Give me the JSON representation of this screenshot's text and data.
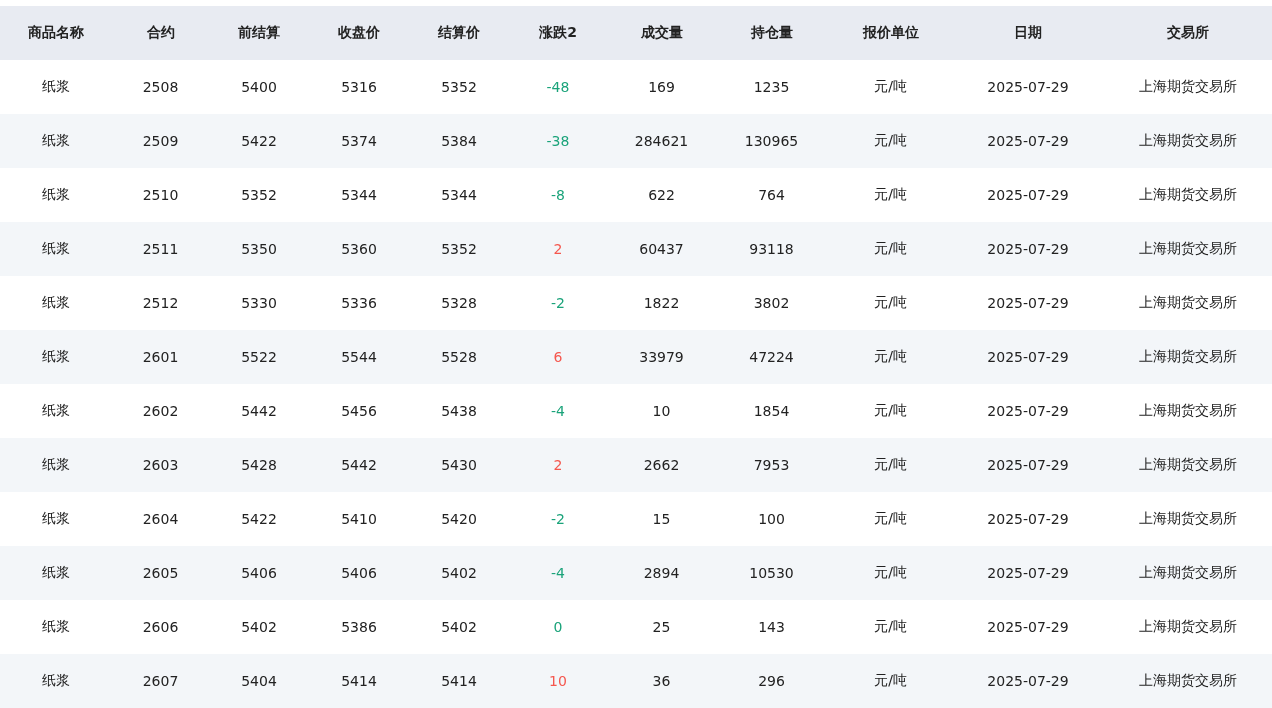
{
  "table": {
    "columns": [
      "商品名称",
      "合约",
      "前结算",
      "收盘价",
      "结算价",
      "涨跌2",
      "成交量",
      "持仓量",
      "报价单位",
      "日期",
      "交易所"
    ],
    "rows": [
      {
        "cells": [
          "纸浆",
          "2508",
          "5400",
          "5316",
          "5352",
          "-48",
          "169",
          "1235",
          "元/吨",
          "2025-07-29",
          "上海期货交易所"
        ],
        "color": "#1aa37a"
      },
      {
        "cells": [
          "纸浆",
          "2509",
          "5422",
          "5374",
          "5384",
          "-38",
          "284621",
          "130965",
          "元/吨",
          "2025-07-29",
          "上海期货交易所"
        ],
        "color": "#1aa37a"
      },
      {
        "cells": [
          "纸浆",
          "2510",
          "5352",
          "5344",
          "5344",
          "-8",
          "622",
          "764",
          "元/吨",
          "2025-07-29",
          "上海期货交易所"
        ],
        "color": "#1aa37a"
      },
      {
        "cells": [
          "纸浆",
          "2511",
          "5350",
          "5360",
          "5352",
          "2",
          "60437",
          "93118",
          "元/吨",
          "2025-07-29",
          "上海期货交易所"
        ],
        "color": "#f5574e"
      },
      {
        "cells": [
          "纸浆",
          "2512",
          "5330",
          "5336",
          "5328",
          "-2",
          "1822",
          "3802",
          "元/吨",
          "2025-07-29",
          "上海期货交易所"
        ],
        "color": "#1aa37a"
      },
      {
        "cells": [
          "纸浆",
          "2601",
          "5522",
          "5544",
          "5528",
          "6",
          "33979",
          "47224",
          "元/吨",
          "2025-07-29",
          "上海期货交易所"
        ],
        "color": "#f5574e"
      },
      {
        "cells": [
          "纸浆",
          "2602",
          "5442",
          "5456",
          "5438",
          "-4",
          "10",
          "1854",
          "元/吨",
          "2025-07-29",
          "上海期货交易所"
        ],
        "color": "#1aa37a"
      },
      {
        "cells": [
          "纸浆",
          "2603",
          "5428",
          "5442",
          "5430",
          "2",
          "2662",
          "7953",
          "元/吨",
          "2025-07-29",
          "上海期货交易所"
        ],
        "color": "#f5574e"
      },
      {
        "cells": [
          "纸浆",
          "2604",
          "5422",
          "5410",
          "5420",
          "-2",
          "15",
          "100",
          "元/吨",
          "2025-07-29",
          "上海期货交易所"
        ],
        "color": "#1aa37a"
      },
      {
        "cells": [
          "纸浆",
          "2605",
          "5406",
          "5406",
          "5402",
          "-4",
          "2894",
          "10530",
          "元/吨",
          "2025-07-29",
          "上海期货交易所"
        ],
        "color": "#1aa37a"
      },
      {
        "cells": [
          "纸浆",
          "2606",
          "5402",
          "5386",
          "5402",
          "0",
          "25",
          "143",
          "元/吨",
          "2025-07-29",
          "上海期货交易所"
        ],
        "color": "#1aa37a"
      },
      {
        "cells": [
          "纸浆",
          "2607",
          "5404",
          "5414",
          "5414",
          "10",
          "36",
          "296",
          "元/吨",
          "2025-07-29",
          "上海期货交易所"
        ],
        "color": "#f5574e"
      }
    ]
  }
}
